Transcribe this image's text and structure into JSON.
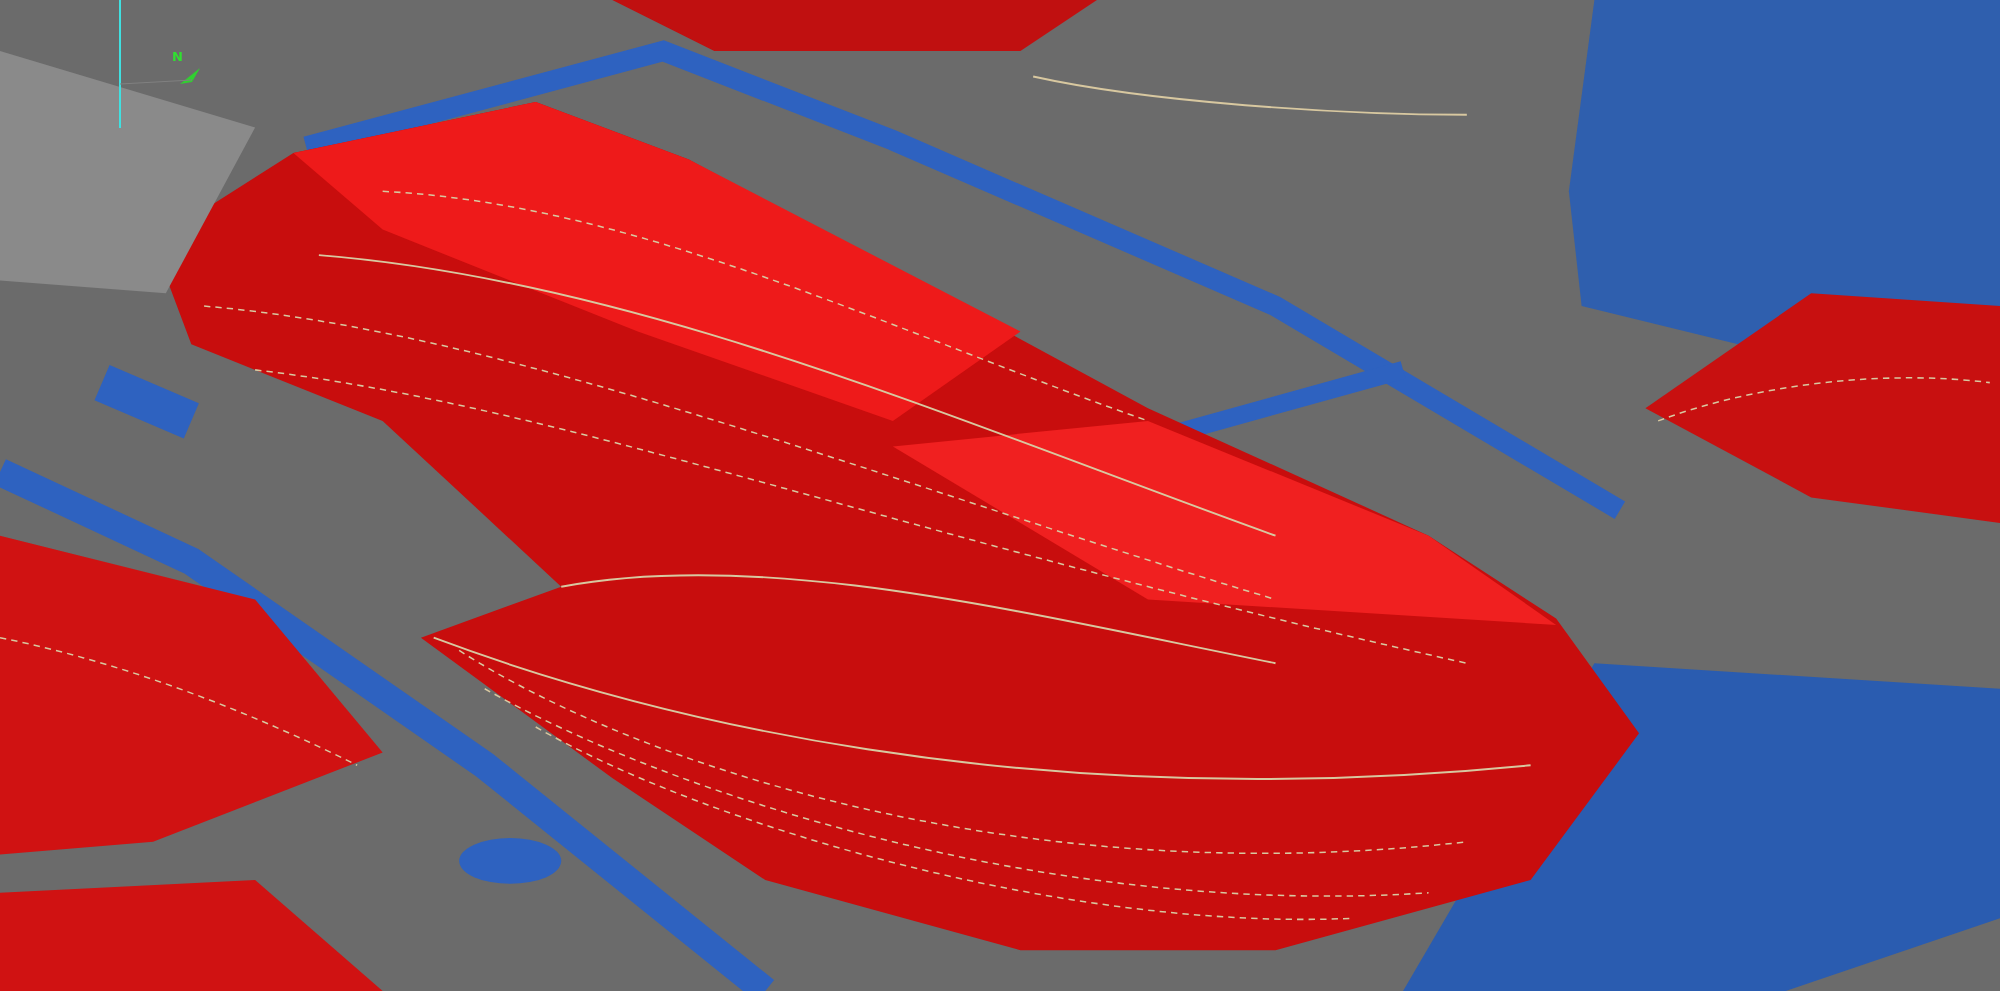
{
  "viewport": {
    "compass": {
      "label": "N"
    }
  }
}
